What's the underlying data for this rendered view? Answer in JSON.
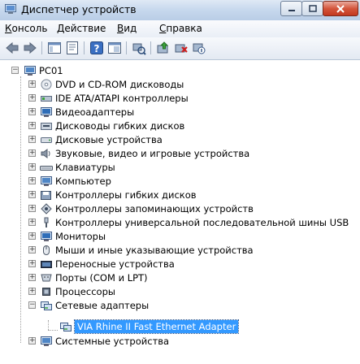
{
  "window": {
    "title": "Диспетчер устройств"
  },
  "menu": [
    {
      "label": "Консоль",
      "underline": "К",
      "rest": "онсоль"
    },
    {
      "label": "Действие",
      "underline": "Д",
      "rest": "ействие"
    },
    {
      "label": "Вид",
      "underline": "В",
      "rest": "ид"
    },
    {
      "label": "Справка",
      "underline": "С",
      "rest": "правка"
    }
  ],
  "tree": {
    "root": "PC01",
    "categories": [
      {
        "label": "DVD и CD-ROM дисководы",
        "icon": "dvd-drive-icon"
      },
      {
        "label": "IDE ATA/ATAPI контроллеры",
        "icon": "ide-controller-icon"
      },
      {
        "label": "Видеоадаптеры",
        "icon": "display-adapter-icon"
      },
      {
        "label": "Дисководы гибких дисков",
        "icon": "floppy-drive-icon"
      },
      {
        "label": "Дисковые устройства",
        "icon": "disk-drive-icon"
      },
      {
        "label": "Звуковые, видео и игровые устройства",
        "icon": "speaker-icon"
      },
      {
        "label": "Клавиатуры",
        "icon": "keyboard-icon"
      },
      {
        "label": "Компьютер",
        "icon": "computer-icon"
      },
      {
        "label": "Контроллеры гибких дисков",
        "icon": "floppy-controller-icon"
      },
      {
        "label": "Контроллеры запоминающих устройств",
        "icon": "storage-controller-icon"
      },
      {
        "label": "Контроллеры универсальной последовательной шины USB",
        "icon": "usb-icon"
      },
      {
        "label": "Мониторы",
        "icon": "monitor-icon"
      },
      {
        "label": "Мыши и иные указывающие устройства",
        "icon": "mouse-icon"
      },
      {
        "label": "Переносные устройства",
        "icon": "portable-device-icon"
      },
      {
        "label": "Порты (COM и LPT)",
        "icon": "port-icon"
      },
      {
        "label": "Процессоры",
        "icon": "processor-icon"
      },
      {
        "label": "Сетевые адаптеры",
        "icon": "network-adapter-icon",
        "expanded": true
      },
      {
        "label": "Системные устройства",
        "icon": "system-device-icon"
      }
    ],
    "network_child": {
      "label": "VIA Rhine II Fast Ethernet Adapter",
      "icon": "network-card-icon"
    }
  },
  "colors": {
    "selection": "#3399ff",
    "close_button": "#c3381f",
    "titlebar": "#c8d9ee"
  }
}
